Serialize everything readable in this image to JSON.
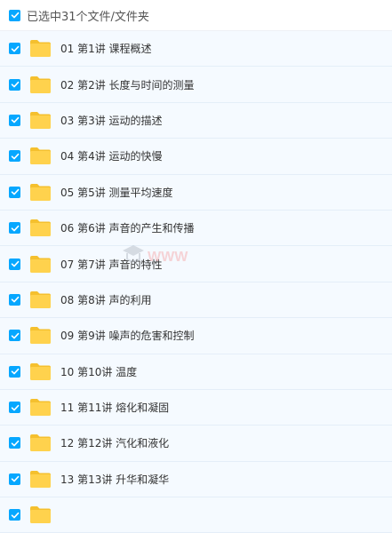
{
  "header": {
    "selected_label": "已选中31个文件/文件夹"
  },
  "files": [
    {
      "name": "01 第1讲 课程概述"
    },
    {
      "name": "02 第2讲 长度与时间的测量"
    },
    {
      "name": "03 第3讲 运动的描述"
    },
    {
      "name": "04 第4讲 运动的快慢"
    },
    {
      "name": "05 第5讲 测量平均速度"
    },
    {
      "name": "06 第6讲 声音的产生和传播"
    },
    {
      "name": "07 第7讲 声音的特性"
    },
    {
      "name": "08 第8讲 声的利用"
    },
    {
      "name": "09 第9讲 噪声的危害和控制"
    },
    {
      "name": "10 第10讲 温度"
    },
    {
      "name": "11 第11讲 熔化和凝固"
    },
    {
      "name": "12 第12讲 汽化和液化"
    },
    {
      "name": "13 第13讲 升华和凝华"
    },
    {
      "name": ""
    }
  ],
  "colors": {
    "checkbox": "#06a7ff",
    "folder_body": "#ffd24d",
    "folder_tab": "#f5c02e",
    "row_background": "#f5faff"
  },
  "icons": {
    "checkbox": "checkmark-icon",
    "folder": "folder-icon"
  }
}
